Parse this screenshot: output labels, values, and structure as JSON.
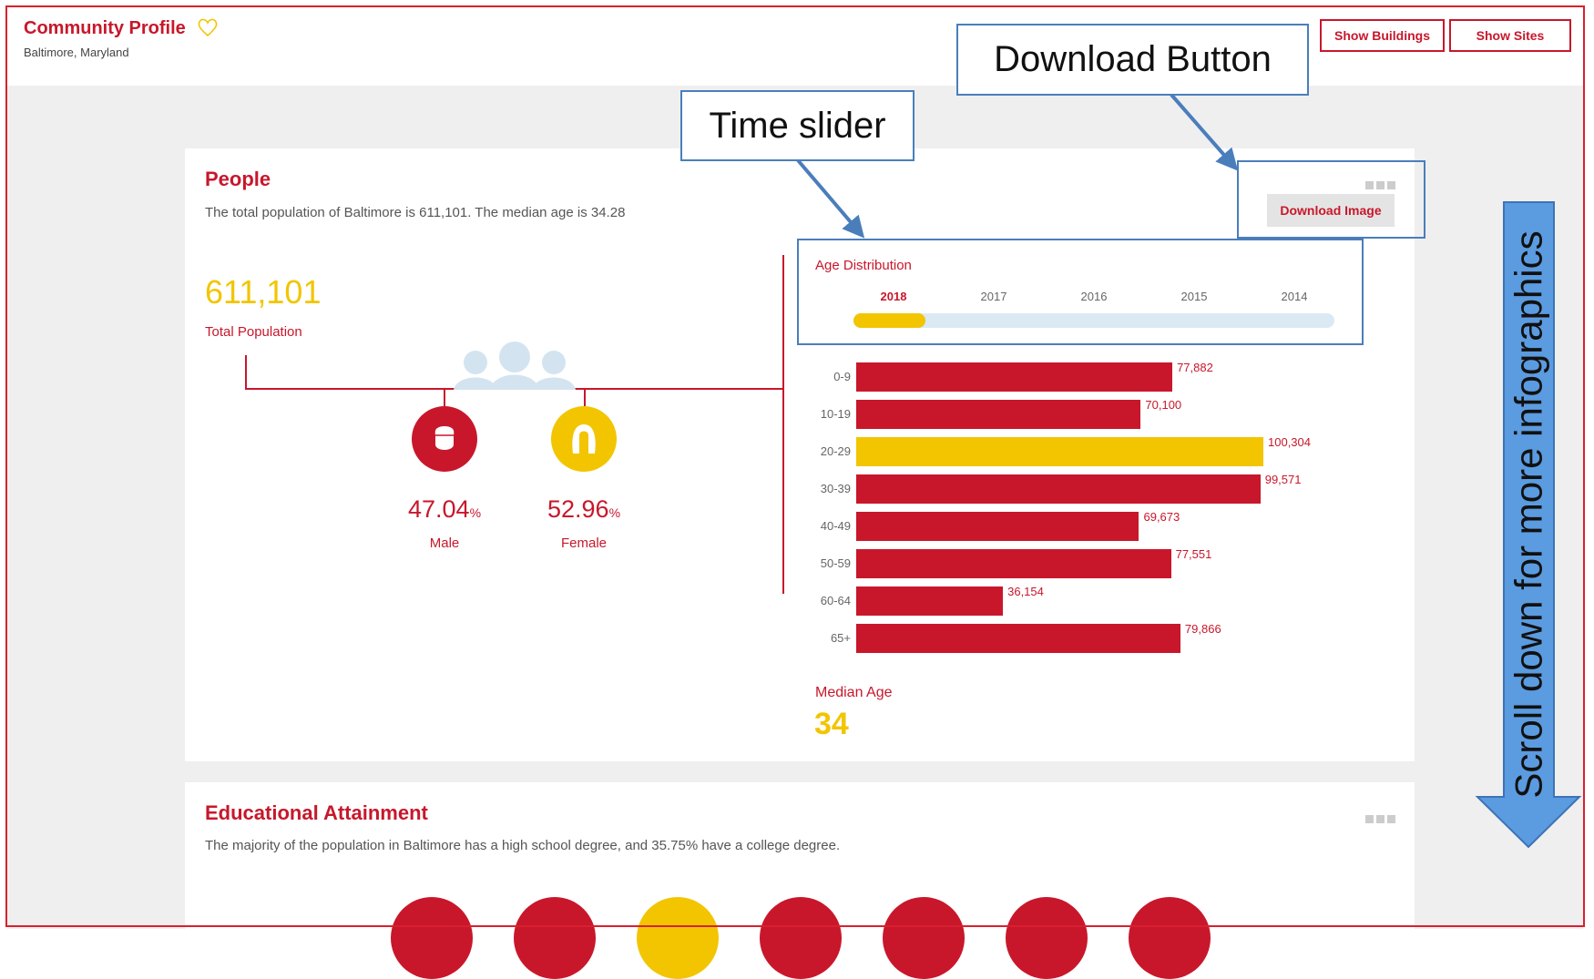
{
  "header": {
    "title": "Community Profile",
    "location": "Baltimore, Maryland",
    "show_buildings_label": "Show Buildings",
    "show_sites_label": "Show Sites"
  },
  "people": {
    "title": "People",
    "description": "The total population of Baltimore is 611,101. The median age is 34.28",
    "download_label": "Download Image",
    "total_population": "611,101",
    "total_population_label": "Total Population",
    "male_pct": "47.04",
    "female_pct": "52.96",
    "pct_sign": "%",
    "male_label": "Male",
    "female_label": "Female",
    "age_distribution_title": "Age Distribution",
    "years": [
      "2018",
      "2017",
      "2016",
      "2015",
      "2014"
    ],
    "selected_year": "2018",
    "slider_progress": 0.15,
    "median_age_label": "Median Age",
    "median_age": "34"
  },
  "chart_data": {
    "type": "bar",
    "title": "Age Distribution",
    "orientation": "horizontal",
    "categories": [
      "0-9",
      "10-19",
      "20-29",
      "30-39",
      "40-49",
      "50-59",
      "60-64",
      "65+"
    ],
    "values": [
      77882,
      70100,
      100304,
      99571,
      69673,
      77551,
      36154,
      79866
    ],
    "value_labels": [
      "77,882",
      "70,100",
      "100,304",
      "99,571",
      "69,673",
      "77,551",
      "36,154",
      "79,866"
    ],
    "highlight_index": 2,
    "colors": {
      "default": "#c8172b",
      "highlight": "#f2c500"
    },
    "xlim": [
      0,
      100304
    ]
  },
  "education": {
    "title": "Educational Attainment",
    "description": "The majority of the population in Baltimore has a high school degree, and 35.75% have a college degree."
  },
  "annotations": {
    "time_slider": "Time slider",
    "download_button": "Download Button",
    "scroll_hint": "Scroll down for more infographics"
  },
  "colors": {
    "brand_red": "#c8172b",
    "accent_yellow": "#f2c500",
    "callout_blue": "#4a7ebb"
  }
}
